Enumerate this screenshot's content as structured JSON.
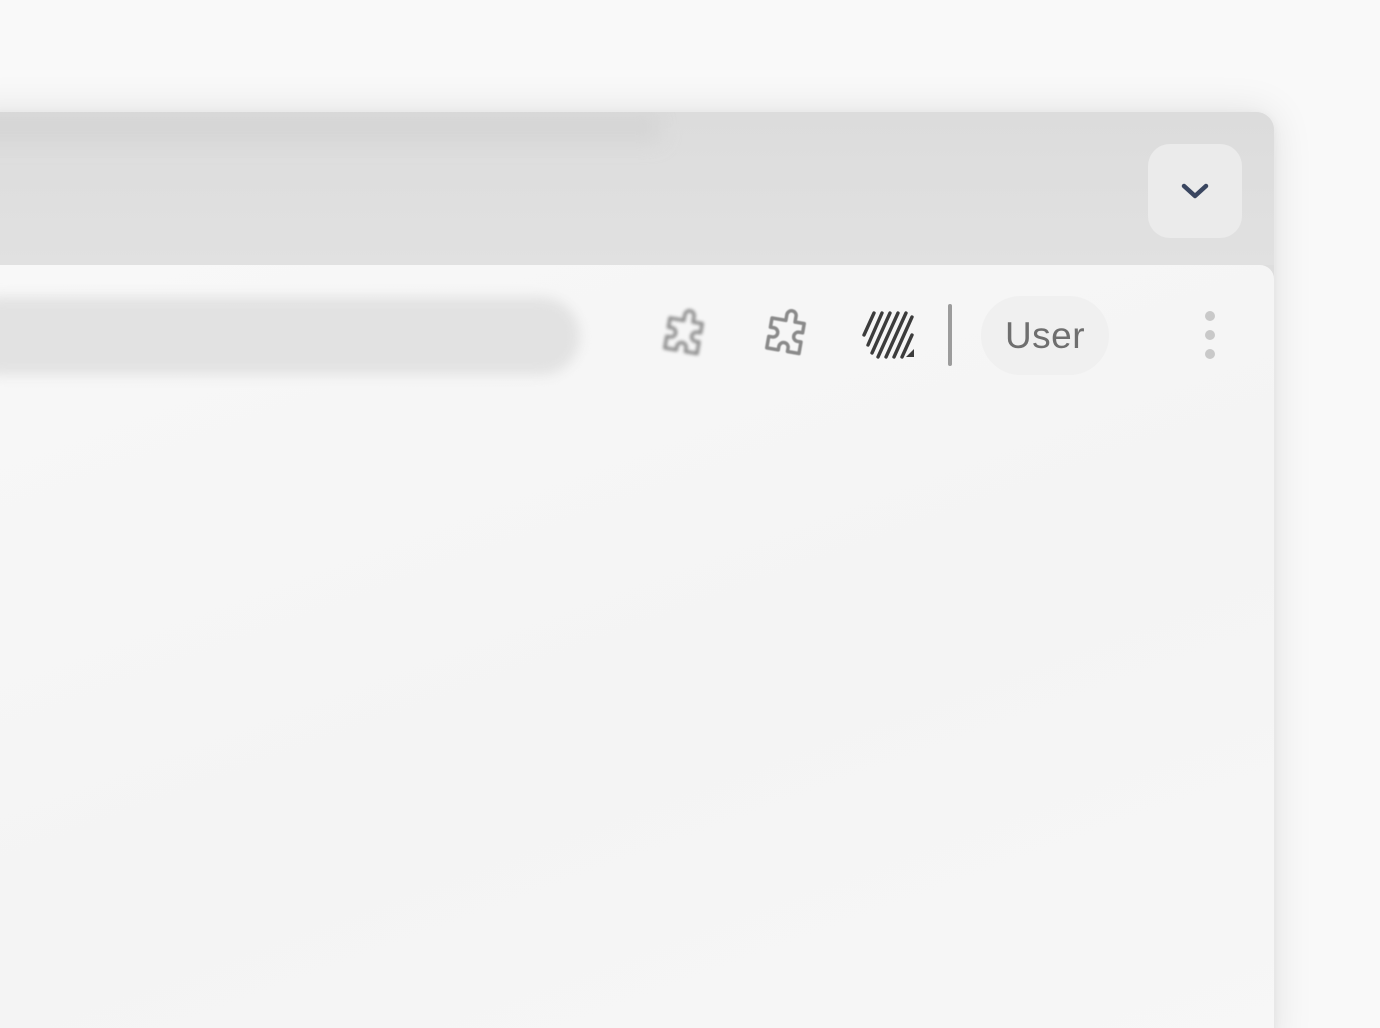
{
  "window": {
    "tab_strip": {
      "tab_search_button": {
        "icon": "chevron-down-icon",
        "color": "#3a4660"
      }
    },
    "toolbar": {
      "extensions": [
        {
          "icon": "puzzle-icon"
        },
        {
          "icon": "puzzle-icon"
        },
        {
          "icon": "striped-extension-icon"
        }
      ],
      "profile_label": "User",
      "menu_icon": "vertical-dots-icon"
    }
  }
}
